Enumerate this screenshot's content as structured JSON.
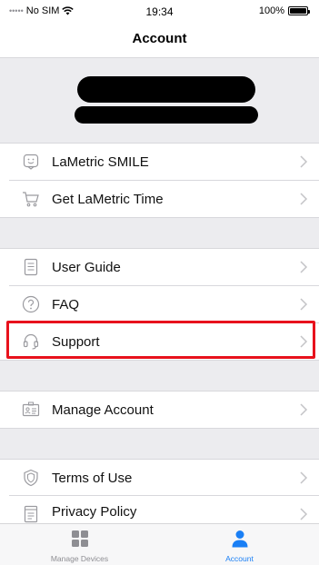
{
  "status_bar": {
    "carrier": "No SIM",
    "time": "19:34",
    "battery": "100%"
  },
  "nav": {
    "title": "Account"
  },
  "groups": [
    {
      "items": [
        {
          "name": "lametric-smile",
          "label": "LaMetric SMILE",
          "icon": "smile-device-icon"
        },
        {
          "name": "get-lametric-time",
          "label": "Get LaMetric Time",
          "icon": "cart-icon"
        }
      ]
    },
    {
      "items": [
        {
          "name": "user-guide",
          "label": "User Guide",
          "icon": "document-icon"
        },
        {
          "name": "faq",
          "label": "FAQ",
          "icon": "question-circle-icon"
        },
        {
          "name": "support",
          "label": "Support",
          "icon": "headset-icon"
        }
      ]
    },
    {
      "items": [
        {
          "name": "manage-account",
          "label": "Manage Account",
          "icon": "id-card-icon"
        }
      ]
    },
    {
      "items": [
        {
          "name": "terms-of-use",
          "label": "Terms of Use",
          "icon": "shield-icon"
        },
        {
          "name": "privacy-policy",
          "label": "Privacy Policy",
          "icon": "policy-document-icon"
        }
      ]
    }
  ],
  "tab_bar": {
    "tabs": [
      {
        "label": "Manage Devices",
        "icon": "grid-icon",
        "selected": false
      },
      {
        "label": "Account",
        "icon": "person-icon",
        "selected": true
      }
    ]
  },
  "colors": {
    "accent": "#1a7ff5",
    "highlight": "#e8121c",
    "section_bg": "#ececef",
    "inactive_tab": "#8e8e93",
    "icon_gray": "#9a9a9f"
  }
}
